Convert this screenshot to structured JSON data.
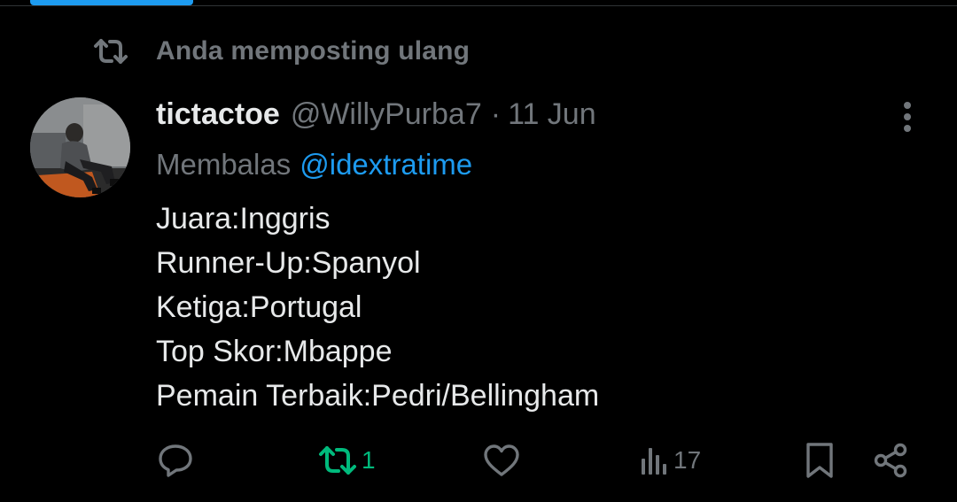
{
  "colors": {
    "background": "#000000",
    "text_primary": "#e7e9ea",
    "text_secondary": "#71767b",
    "accent_blue": "#1d9bf0",
    "repost_green": "#00ba7c"
  },
  "social_context": {
    "icon": "repost-icon",
    "label": "Anda memposting ulang"
  },
  "tweet": {
    "avatar": "user-avatar-photo",
    "display_name": "tictactoe",
    "handle": "@WillyPurba7",
    "separator": "·",
    "date": "11 Jun",
    "replying_to_prefix": "Membalas",
    "replying_to_handle": "@idextratime",
    "lines": [
      "Juara:Inggris",
      "Runner-Up:Spanyol",
      "Ketiga:Portugal",
      "Top Skor:Mbappe",
      "Pemain Terbaik:Pedri/Bellingham"
    ]
  },
  "actions": {
    "reply": {
      "icon": "reply-icon"
    },
    "repost": {
      "icon": "repost-icon",
      "count": "1",
      "active": true
    },
    "like": {
      "icon": "heart-icon"
    },
    "views": {
      "icon": "views-icon",
      "count": "17"
    },
    "bookmark": {
      "icon": "bookmark-icon"
    },
    "share": {
      "icon": "share-icon"
    }
  }
}
